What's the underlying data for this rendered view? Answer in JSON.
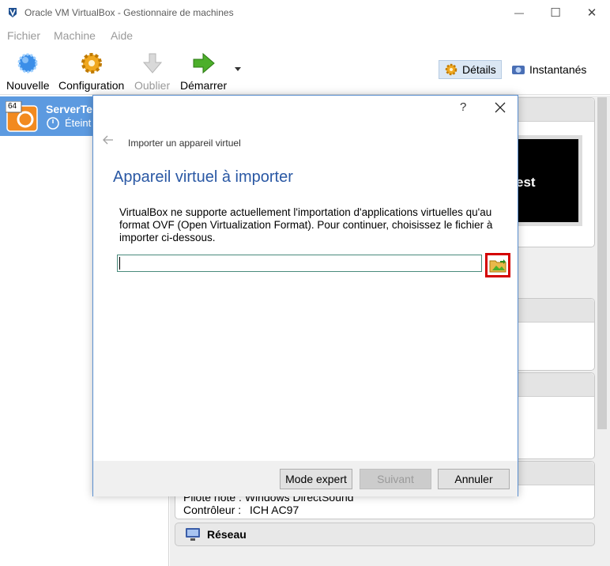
{
  "window": {
    "title": "Oracle VM VirtualBox - Gestionnaire de machines",
    "minimize_glyph": "—",
    "maximize_glyph": "☐",
    "close_glyph": "✕"
  },
  "menu": [
    "Fichier",
    "Machine",
    "Aide"
  ],
  "toolbar": {
    "new_label": "Nouvelle",
    "settings_label": "Configuration",
    "discard_label": "Oublier",
    "start_label": "Démarrer",
    "details_label": "Détails",
    "snapshots_label": "Instantanés"
  },
  "vm": {
    "name": "ServerTe",
    "state": "Éteint",
    "badge": "64"
  },
  "details": {
    "preview_text": "est",
    "audio_host_row": "Pilote hôte :   Windows DirectSound",
    "audio_controller_label": "Contrôleur :",
    "audio_controller_value": "ICH AC97",
    "network_header": "Réseau"
  },
  "dialog": {
    "help": "?",
    "breadcrumb": "Importer un appareil virtuel",
    "heading": "Appareil virtuel à importer",
    "description": "VirtualBox ne supporte actuellement l'importation d'applications virtuelles qu'au format OVF (Open Virtualization Format). Pour continuer, choisissez le fichier à importer ci-dessous.",
    "file_value": "",
    "buttons": {
      "expert": "Mode expert",
      "next": "Suivant",
      "cancel": "Annuler"
    }
  },
  "colors": {
    "selection": "#5c9ae0",
    "heading": "#2a58a4",
    "highlight_box": "#d40000"
  }
}
